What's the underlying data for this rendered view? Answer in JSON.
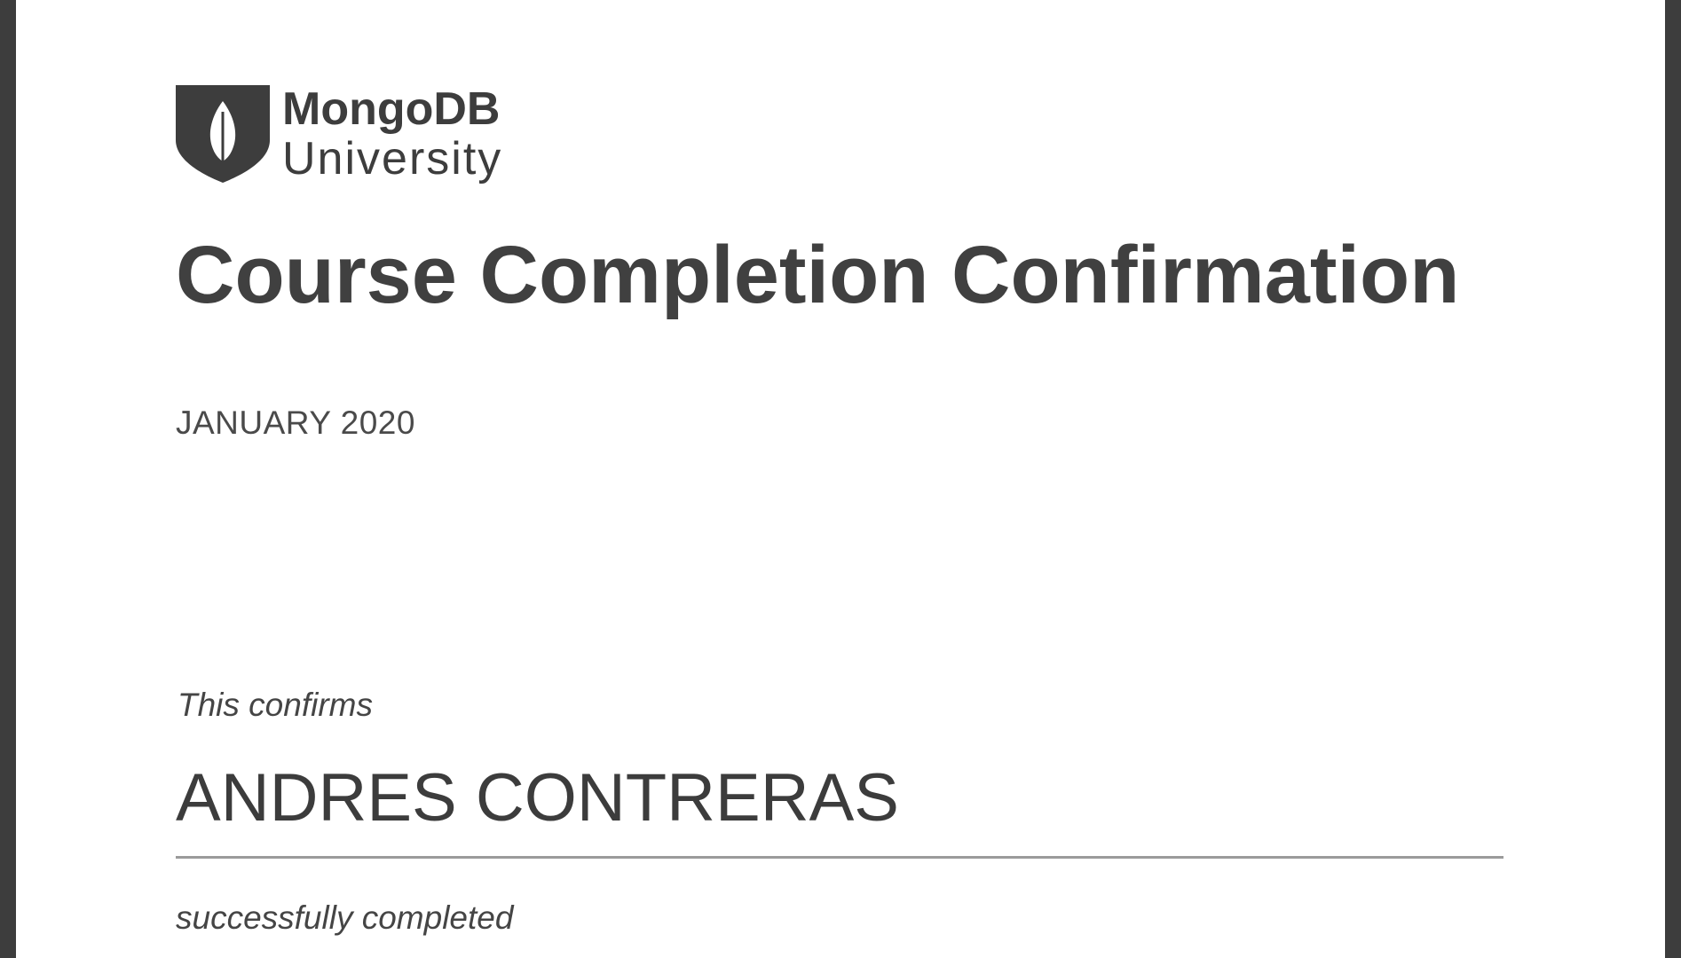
{
  "logo": {
    "brand": "MongoDB",
    "sub": "University",
    "icon": "shield-leaf-icon"
  },
  "certificate": {
    "title": "Course Completion Confirmation",
    "date": "JANUARY 2020",
    "confirms_text": "This confirms",
    "recipient_name": "ANDRES CONTRERAS",
    "completed_text": "successfully completed"
  },
  "colors": {
    "border": "#3d3d3d",
    "text": "#404040",
    "rule": "#9a9a9a"
  }
}
